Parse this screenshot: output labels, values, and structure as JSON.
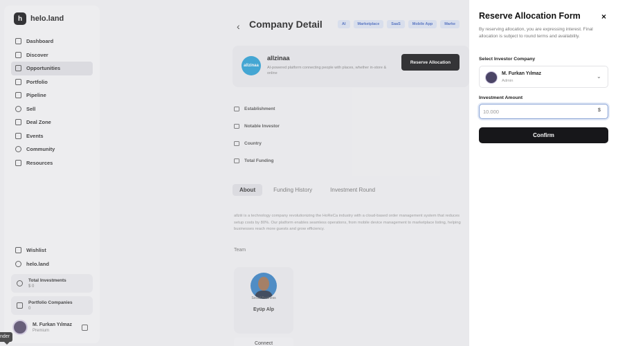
{
  "sidebar": {
    "logo_mark": "h",
    "brand": "helo.land",
    "items": [
      {
        "label": "Dashboard"
      },
      {
        "label": "Discover"
      },
      {
        "label": "Opportunities"
      },
      {
        "label": "Portfolio"
      },
      {
        "label": "Pipeline"
      },
      {
        "label": "Sell"
      },
      {
        "label": "Deal Zone"
      },
      {
        "label": "Events"
      },
      {
        "label": "Community"
      },
      {
        "label": "Resources"
      }
    ],
    "bottom_links": [
      {
        "label": "Wishlist"
      },
      {
        "label": "helo.land"
      }
    ],
    "stats": [
      {
        "label": "Total Investments",
        "value": "$ 0"
      },
      {
        "label": "Portfolio Companies",
        "value": "0"
      }
    ],
    "user": {
      "name": "M. Furkan Yılmaz",
      "role": "Premium"
    },
    "tooltip": "nder"
  },
  "main": {
    "back_glyph": "‹",
    "title": "Company Detail",
    "tags": [
      "AI",
      "Marketplace",
      "SaaS",
      "Mobile App",
      "Marke"
    ],
    "company": {
      "logo_text": "allzinaa",
      "name": "allzinaa",
      "description": "AI-powered platform connecting people with places, whether in-store & online",
      "reserve_label": "Reserve Allocation"
    },
    "info_rows": [
      "Establishment",
      "Notable Investor",
      "Country",
      "Total Funding"
    ],
    "tabs": [
      "About",
      "Funding History",
      "Investment Round"
    ],
    "about": "allziii is a technology company revolutionizing the HoReCa industry with a cloud-based order management system that reduces setup costs by 80%. Our platform enables seamless operations, from mobile device management to marketplace listing, helping businesses reach more guests and grow efficiency.",
    "team_label": "Team",
    "team": [
      {
        "role": "Social Business",
        "name": "Eyüp Alp",
        "connect_label": "Connect"
      }
    ]
  },
  "panel": {
    "title": "Reserve Allocation Form",
    "close_glyph": "×",
    "description": "By reserving allocation, you are expressing interest. Final allocation is subject to round terms and availability.",
    "investor_label": "Select Investor Company",
    "investor": {
      "name": "M. Furkan Yılmaz",
      "role": "Admin"
    },
    "chevron_glyph": "⌄",
    "amount_label": "Investment Amount",
    "amount_value": "10.000",
    "currency": "$",
    "confirm_label": "Confirm"
  }
}
